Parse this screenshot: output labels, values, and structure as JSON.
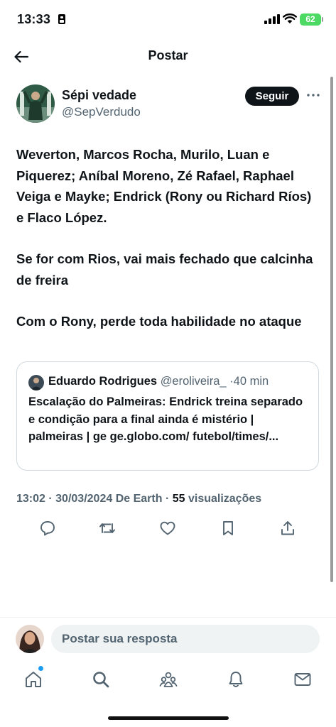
{
  "status_bar": {
    "time": "13:33",
    "battery": "62"
  },
  "header": {
    "title": "Postar"
  },
  "author": {
    "name": "Sépi vedade",
    "handle": "@SepVerdudo",
    "follow_label": "Seguir"
  },
  "tweet": {
    "paragraphs": [
      "Weverton, Marcos Rocha, Murilo, Luan e Piquerez; Aníbal Moreno, Zé Rafael, Raphael Veiga e Mayke; Endrick (Rony ou Richard Ríos) e Flaco López.",
      "Se for com Rios, vai mais fechado que calcinha de freira",
      "Com o Rony, perde toda habilidade no ataque"
    ]
  },
  "quote": {
    "name": "Eduardo Rodrigues",
    "handle": "@eroliveira_",
    "separator": "·",
    "age": "40 min",
    "text": "Escalação do Palmeiras: Endrick treina separado e condição para a final ainda é mistério | palmeiras | ge ge.globo.com/ futebol/times/..."
  },
  "meta": {
    "time": "13:02",
    "sep1": "·",
    "date": "30/03/2024",
    "source": "De Earth",
    "sep2": "·",
    "views_count": "55",
    "views_label": "visualizações"
  },
  "actions": {
    "reply_icon": "reply-icon",
    "retweet_icon": "retweet-icon",
    "like_icon": "heart-icon",
    "bookmark_icon": "bookmark-icon",
    "share_icon": "share-icon"
  },
  "reply_bar": {
    "placeholder": "Postar sua resposta"
  },
  "nav": {
    "items": [
      "home-icon",
      "search-icon",
      "communities-icon",
      "bell-icon",
      "mail-icon"
    ],
    "accent": "#1d9bf0"
  },
  "colors": {
    "text": "#0f1419",
    "muted": "#536471",
    "border": "#cfd9de",
    "battery": "#4cd964"
  }
}
